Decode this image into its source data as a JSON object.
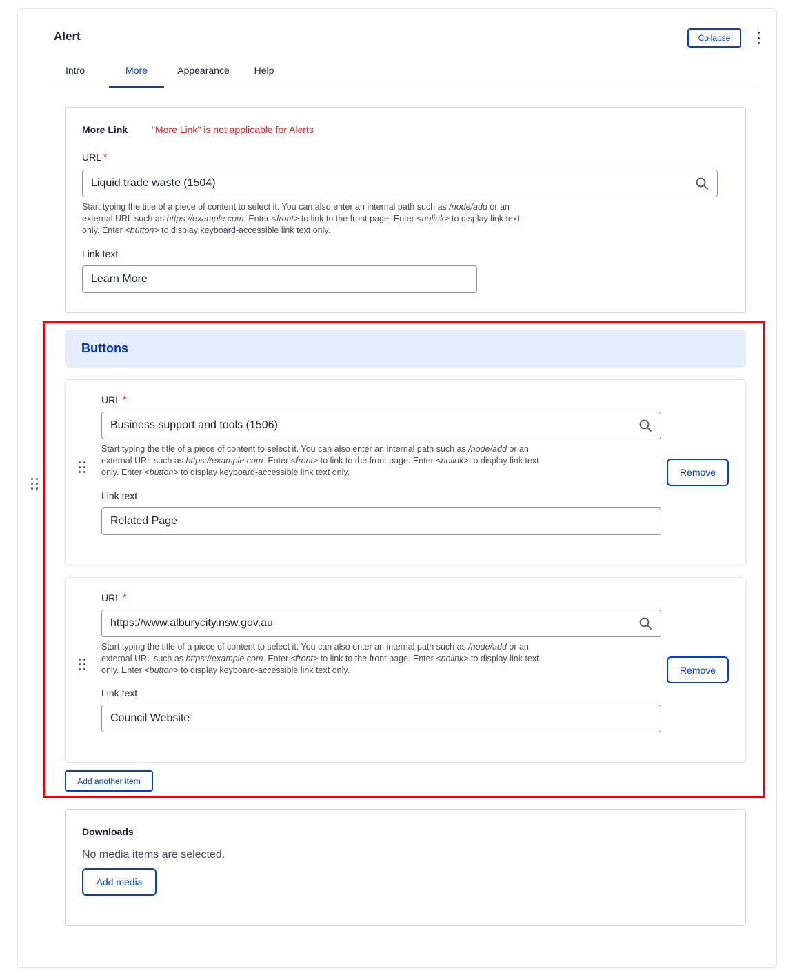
{
  "header": {
    "title": "Alert",
    "collapse_label": "Collapse",
    "kebab_icon": "more-vertical-icon"
  },
  "tabs": [
    {
      "label": "Intro",
      "active": false
    },
    {
      "label": "More",
      "active": true
    },
    {
      "label": "Appearance",
      "active": false
    },
    {
      "label": "Help",
      "active": false
    }
  ],
  "more_link": {
    "label": "More Link",
    "warning": "\"More Link\" is not applicable for Alerts",
    "url_label": "URL",
    "required_mark": "*",
    "url_value": "Liquid trade waste (1504)",
    "help": {
      "p1": "Start typing the title of a piece of content to select it. You can also enter an internal path such as ",
      "p2": "/node/add",
      "p3": " or an external URL such as ",
      "p4": "https://example.com",
      "p5": ". Enter ",
      "p6": "<front>",
      "p7": " to link to the front page. Enter ",
      "p8": "<nolink>",
      "p9": " to display link text only. Enter ",
      "p10": "<button>",
      "p11": " to display keyboard-accessible link text only."
    },
    "link_text_label": "Link text",
    "link_text_value": "Learn More"
  },
  "buttons": {
    "header": "Buttons",
    "items": [
      {
        "url_label": "URL",
        "url_value": "Business support and tools (1506)",
        "link_text_label": "Link text",
        "link_text_value": "Related Page",
        "remove_label": "Remove"
      },
      {
        "url_label": "URL",
        "url_value": "https://www.alburycity.nsw.gov.au",
        "link_text_label": "Link text",
        "link_text_value": "Council Website",
        "remove_label": "Remove"
      }
    ],
    "add_another_label": "Add another item"
  },
  "downloads": {
    "label": "Downloads",
    "empty_text": "No media items are selected.",
    "add_media_label": "Add media"
  },
  "colors": {
    "accent": "#003ecc",
    "required": "#d72222",
    "highlight": "#e4000f",
    "buttons_header_bg": "#e5edfc"
  }
}
